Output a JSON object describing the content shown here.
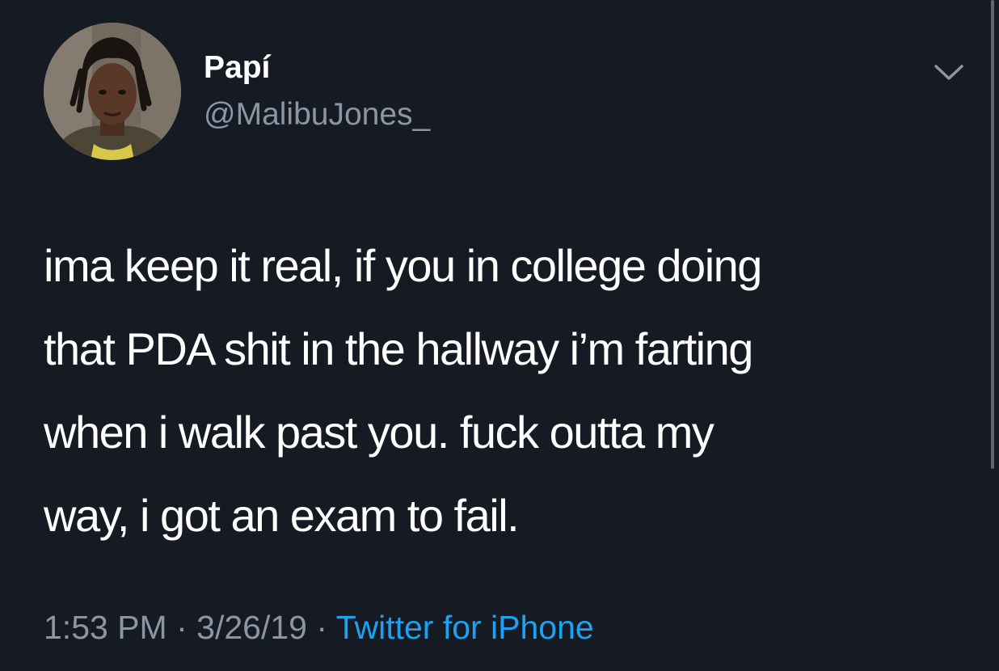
{
  "author": {
    "display_name": "Papí",
    "handle": "@MalibuJones_",
    "avatar": "profile-photo"
  },
  "tweet": {
    "lines": [
      "ima keep it real, if you in college doing",
      "that PDA shit in the hallway i’m farting",
      "when i walk past you. fuck outta my",
      "way, i got an exam to fail."
    ]
  },
  "meta": {
    "time": "1:53 PM",
    "separator": "·",
    "date": "3/26/19",
    "source": "Twitter for iPhone"
  },
  "icons": {
    "menu": "chevron-down-icon"
  },
  "colors": {
    "background": "#151a23",
    "text": "#ffffff",
    "secondary_text": "#8a96a3",
    "link": "#1da1f2"
  }
}
